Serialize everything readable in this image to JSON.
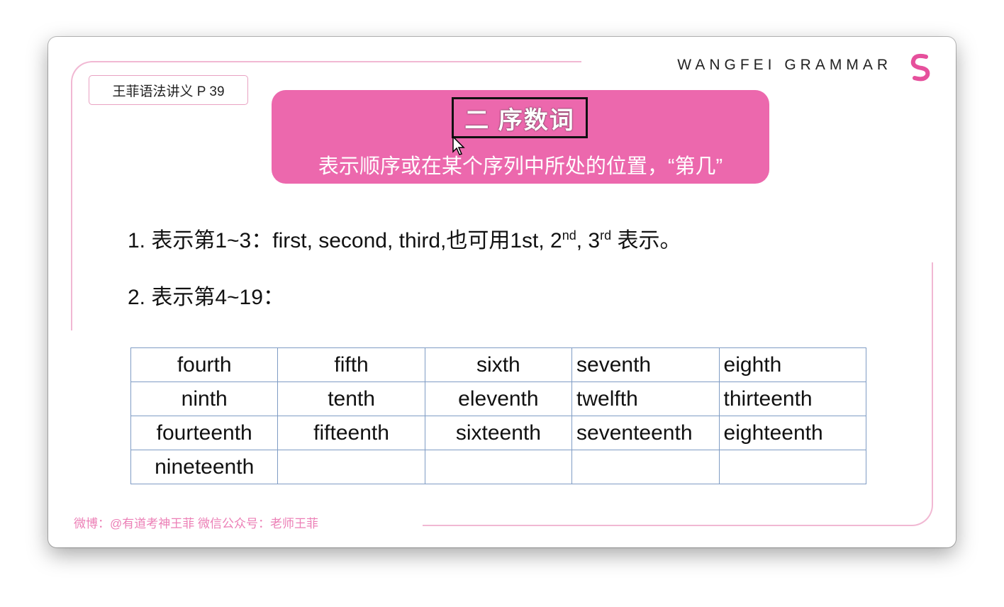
{
  "brand": "WANGFEI GRAMMAR",
  "page_tag": "王菲语法讲义 P 39",
  "banner": {
    "title": "二  序数词",
    "subtitle": "表示顺序或在某个序列中所处的位置，“第几”",
    "color": "#ec68ad"
  },
  "point1": {
    "prefix": "1. 表示第1~3：first, second, third,也可用1st, 2",
    "sup1": "nd",
    "mid": ", 3",
    "sup2": "rd",
    "suffix": " 表示。"
  },
  "point2": "2. 表示第4~19：",
  "table": [
    [
      "fourth",
      "fifth",
      "sixth",
      "seventh",
      "eighth"
    ],
    [
      "ninth",
      "tenth",
      "eleventh",
      "twelfth",
      "thirteenth"
    ],
    [
      "fourteenth",
      "fifteenth",
      "sixteenth",
      "seventeenth",
      "eighteenth"
    ],
    [
      "nineteenth",
      "",
      "",
      "",
      ""
    ]
  ],
  "footer": "微博：@有道考神王菲 微信公众号：老师王菲"
}
